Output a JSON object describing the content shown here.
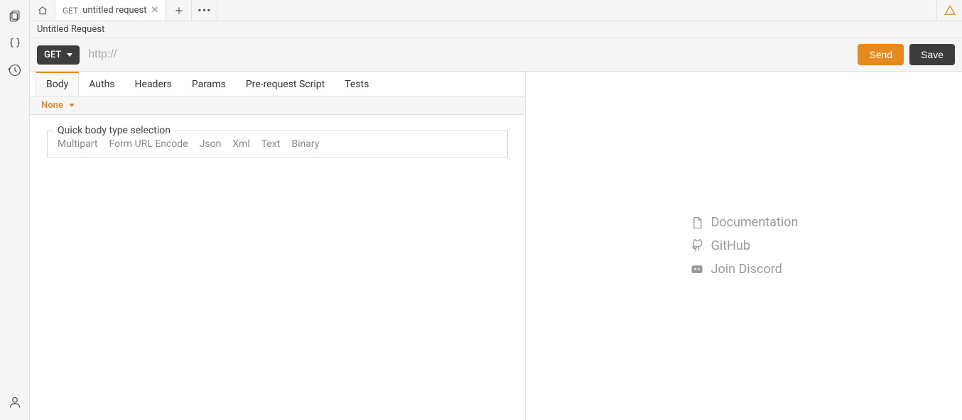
{
  "leftRail": {
    "collections": "collections-icon",
    "env": "curly-braces-icon",
    "history": "history-icon",
    "user": "user-icon"
  },
  "topTabs": {
    "home": "home-icon",
    "tab": {
      "method": "GET",
      "title": "untitled request"
    },
    "plus": "plus-icon",
    "menu": "•••",
    "warn": "warning-icon"
  },
  "request": {
    "name": "Untitled Request",
    "method": "GET",
    "urlPlaceholder": "http://",
    "urlValue": "",
    "sendLabel": "Send",
    "saveLabel": "Save"
  },
  "reqTabs": [
    "Body",
    "Auths",
    "Headers",
    "Params",
    "Pre-request Script",
    "Tests"
  ],
  "body": {
    "typeSelected": "None",
    "quickLegend": "Quick body type selection",
    "quickOptions": [
      "Multipart",
      "Form URL Encode",
      "Json",
      "Xml",
      "Text",
      "Binary"
    ]
  },
  "rightLinks": {
    "docs": "Documentation",
    "github": "GitHub",
    "discord": "Join Discord"
  }
}
